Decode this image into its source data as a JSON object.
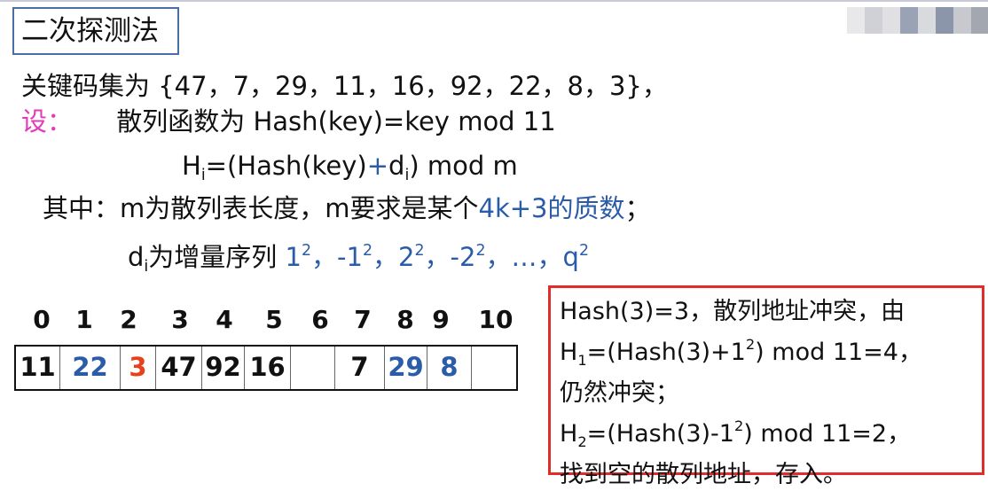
{
  "title": "二次探测法",
  "keys_line": "关键码集为 {47，7，29，11，16，92，22，8，3}，",
  "let_label": "设：",
  "hash_function": "散列函数为  Hash(key)=key mod 11",
  "probe_formula": {
    "h": "H",
    "h_sub": "i",
    "mid": "=(Hash(key)",
    "plus": "+",
    "d": "d",
    "d_sub": "i",
    "tail": ") mod m"
  },
  "where_line": {
    "prefix": "其中：m为散列表长度，m要求是某个",
    "highlight": "4k+3的质数",
    "suffix": "；"
  },
  "increment_line": {
    "d": "d",
    "d_sub": "i",
    "text": "为增量序列 ",
    "seq": [
      "1",
      "2",
      "，-1",
      "2",
      "，2",
      "2",
      "，-2",
      "2",
      "，…，q",
      "2"
    ]
  },
  "table": {
    "indices": [
      "0",
      "1",
      "2",
      "3",
      "4",
      "5",
      "6",
      "7",
      "8",
      "9",
      "10"
    ],
    "cells": [
      "11",
      "22",
      "3",
      "47",
      "92",
      "16",
      "",
      "7",
      "29",
      "8",
      ""
    ],
    "cell_colors": [
      "#111111",
      "#2b5ca8",
      "#e8401c",
      "#111111",
      "#111111",
      "#111111",
      "#111111",
      "#111111",
      "#2b5ca8",
      "#2b5ca8",
      "#111111"
    ]
  },
  "note": {
    "line1": "Hash(3)=3，散列地址冲突，由",
    "line2": {
      "h": "H",
      "sub": "1",
      "a": "=(Hash(3)+1",
      "sup": "2",
      "b": ") mod 11=4，"
    },
    "line3": "仍然冲突；",
    "line4": {
      "h": "H",
      "sub": "2",
      "a": "=(Hash(3)-1",
      "sup": "2",
      "b": ") mod 11=2，"
    },
    "line5": "找到空的散列地址，存入。"
  },
  "colors": {
    "pink": "#e23ab8",
    "blue": "#2b5ca8",
    "red_border": "#e22b2b",
    "title_border": "#4a6fa8"
  }
}
